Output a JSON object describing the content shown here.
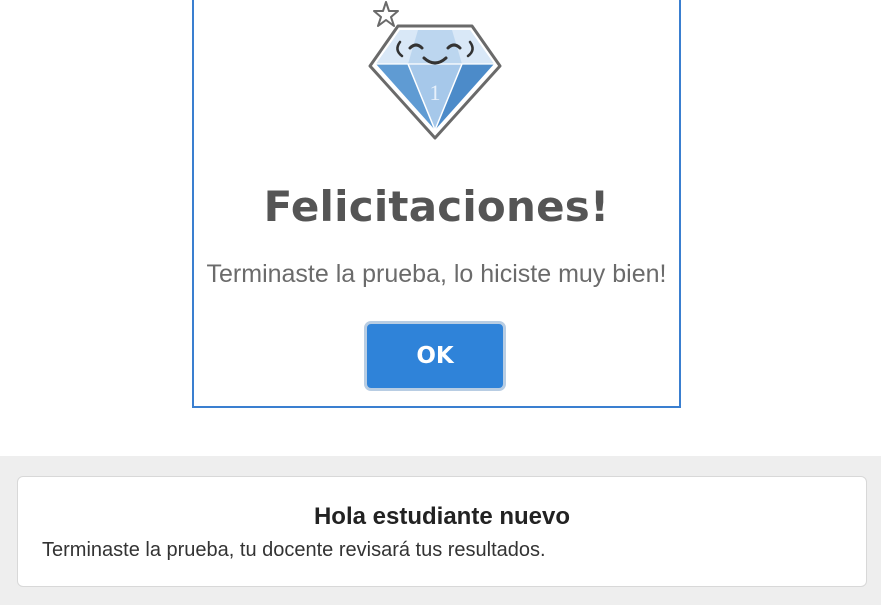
{
  "dialog": {
    "title": "Felicitaciones!",
    "message": "Terminaste la prueba, lo hiciste muy bien!",
    "ok_label": "OK",
    "badge_icon": "diamond-icon",
    "badge_number": "1"
  },
  "notice": {
    "title": "Hola estudiante nuevo",
    "message": "Terminaste la prueba, tu docente revisará tus resultados."
  },
  "colors": {
    "accent": "#2f83d9",
    "dialog_border": "#3a7fd0",
    "background_strip": "#eeeeee"
  }
}
